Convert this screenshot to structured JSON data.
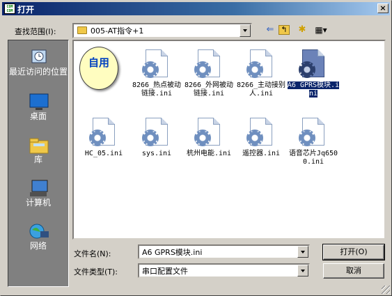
{
  "window": {
    "title": "打开",
    "app_icon_text": "COM\nCOM",
    "close_glyph": "×"
  },
  "location": {
    "label": "查找范围(I):",
    "value": "005-AT指令+1"
  },
  "toolbar": {
    "back_glyph": "⇐",
    "up_glyph": "↰",
    "new_folder_glyph": "✱",
    "view_glyph": "▦▾"
  },
  "sidebar": {
    "items": [
      {
        "label": "最近访问的位置",
        "icon": "recent-places-icon"
      },
      {
        "label": "桌面",
        "icon": "desktop-icon"
      },
      {
        "label": "库",
        "icon": "libraries-icon"
      },
      {
        "label": "计算机",
        "icon": "computer-icon"
      },
      {
        "label": "网络",
        "icon": "network-icon"
      }
    ]
  },
  "files": {
    "special_item": "自用",
    "items": [
      {
        "name": "8266_热点被动链接.ini",
        "selected": false
      },
      {
        "name": "8266_外网被动链接.ini",
        "selected": false
      },
      {
        "name": "8266_主动接别人.ini",
        "selected": false
      },
      {
        "name": "A6 GPRS模块.ini",
        "selected": true
      },
      {
        "name": "HC_05.ini",
        "selected": false
      },
      {
        "name": "sys.ini",
        "selected": false
      },
      {
        "name": "杭州电能.ini",
        "selected": false
      },
      {
        "name": "遥控器.ini",
        "selected": false
      },
      {
        "name": "语音芯片Jq6500.ini",
        "selected": false
      }
    ]
  },
  "filename": {
    "label": "文件名(N):",
    "value": "A6 GPRS模块.ini"
  },
  "filetype": {
    "label": "文件类型(T):",
    "value": "串口配置文件"
  },
  "buttons": {
    "open": "打开(O)",
    "cancel": "取消"
  },
  "colors": {
    "titlebar_start": "#0a246a",
    "titlebar_end": "#a6caf0",
    "dialog_bg": "#d4d0c8",
    "sidebar_bg": "#808080",
    "selection": "#0a246a"
  }
}
